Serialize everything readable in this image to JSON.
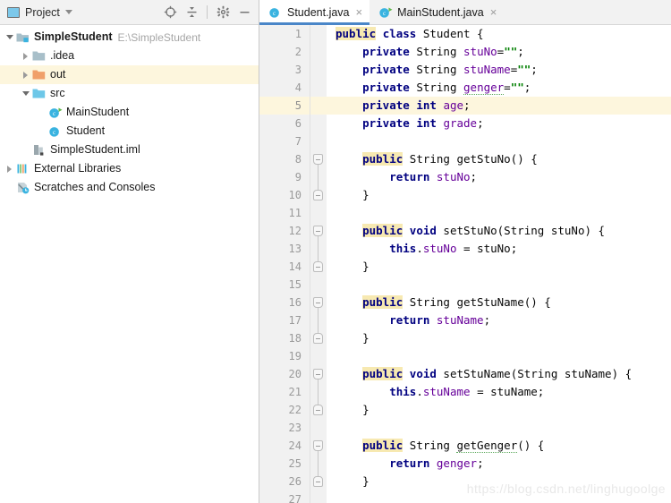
{
  "project_panel": {
    "header": {
      "icon": "project-window-icon",
      "title": "Project",
      "dropdown_icon": "chevron-down-icon",
      "actions": [
        {
          "name": "locate-in-tree-icon",
          "glyph": "target"
        },
        {
          "name": "collapse-all-icon",
          "glyph": "collapse"
        },
        {
          "name": "settings-gear-icon",
          "glyph": "gear"
        },
        {
          "name": "hide-panel-icon",
          "glyph": "minus"
        }
      ]
    },
    "tree": [
      {
        "label": "SimpleStudent",
        "path": "E:\\SimpleStudent",
        "icon": "module-icon",
        "twisty": "down",
        "indent": 0,
        "bold": true,
        "highlight": false
      },
      {
        "label": ".idea",
        "path": "",
        "icon": "folder-grey-icon",
        "twisty": "right",
        "indent": 1,
        "bold": false,
        "highlight": false
      },
      {
        "label": "out",
        "path": "",
        "icon": "folder-orange-icon",
        "twisty": "right",
        "indent": 1,
        "bold": false,
        "highlight": true
      },
      {
        "label": "src",
        "path": "",
        "icon": "folder-source-icon",
        "twisty": "down",
        "indent": 1,
        "bold": false,
        "highlight": false
      },
      {
        "label": "MainStudent",
        "path": "",
        "icon": "java-runnable-class-icon",
        "twisty": "none",
        "indent": 2,
        "bold": false,
        "highlight": false
      },
      {
        "label": "Student",
        "path": "",
        "icon": "java-class-icon",
        "twisty": "none",
        "indent": 2,
        "bold": false,
        "highlight": false
      },
      {
        "label": "SimpleStudent.iml",
        "path": "",
        "icon": "iml-file-icon",
        "twisty": "none",
        "indent": 1,
        "bold": false,
        "highlight": false
      },
      {
        "label": "External Libraries",
        "path": "",
        "icon": "libraries-icon",
        "twisty": "right",
        "indent": 0,
        "bold": false,
        "highlight": false
      },
      {
        "label": "Scratches and Consoles",
        "path": "",
        "icon": "scratches-icon",
        "twisty": "none",
        "indent": 0,
        "bold": false,
        "highlight": false
      }
    ]
  },
  "editor": {
    "tabs": [
      {
        "label": "Student.java",
        "icon": "java-class-icon",
        "active": true,
        "close_glyph": "×"
      },
      {
        "label": "MainStudent.java",
        "icon": "java-runnable-class-icon",
        "active": false,
        "close_glyph": "×"
      }
    ],
    "current_line": 5,
    "lines": [
      {
        "n": 1,
        "indent": 0,
        "tokens": [
          {
            "t": "public",
            "c": "kw-hl"
          },
          {
            "t": " ",
            "c": "plain"
          },
          {
            "t": "class",
            "c": "kw"
          },
          {
            "t": " Student {",
            "c": "plain"
          }
        ]
      },
      {
        "n": 2,
        "indent": 1,
        "tokens": [
          {
            "t": "private",
            "c": "kw"
          },
          {
            "t": " String ",
            "c": "plain"
          },
          {
            "t": "stuNo",
            "c": "fld"
          },
          {
            "t": "=",
            "c": "plain"
          },
          {
            "t": "\"\"",
            "c": "str"
          },
          {
            "t": ";",
            "c": "plain"
          }
        ]
      },
      {
        "n": 3,
        "indent": 1,
        "tokens": [
          {
            "t": "private",
            "c": "kw"
          },
          {
            "t": " String ",
            "c": "plain"
          },
          {
            "t": "stuName",
            "c": "fld"
          },
          {
            "t": "=",
            "c": "plain"
          },
          {
            "t": "\"\"",
            "c": "str"
          },
          {
            "t": ";",
            "c": "plain"
          }
        ]
      },
      {
        "n": 4,
        "indent": 1,
        "tokens": [
          {
            "t": "private",
            "c": "kw"
          },
          {
            "t": " String ",
            "c": "plain"
          },
          {
            "t": "genger",
            "c": "fld typo"
          },
          {
            "t": "=",
            "c": "plain"
          },
          {
            "t": "\"\"",
            "c": "str"
          },
          {
            "t": ";",
            "c": "plain"
          }
        ]
      },
      {
        "n": 5,
        "indent": 1,
        "tokens": [
          {
            "t": "private",
            "c": "kw"
          },
          {
            "t": " ",
            "c": "plain"
          },
          {
            "t": "int",
            "c": "kw"
          },
          {
            "t": " ",
            "c": "plain"
          },
          {
            "t": "age",
            "c": "fld"
          },
          {
            "t": ";",
            "c": "plain"
          }
        ]
      },
      {
        "n": 6,
        "indent": 1,
        "tokens": [
          {
            "t": "private",
            "c": "kw"
          },
          {
            "t": " ",
            "c": "plain"
          },
          {
            "t": "int",
            "c": "kw"
          },
          {
            "t": " ",
            "c": "plain"
          },
          {
            "t": "grade",
            "c": "fld"
          },
          {
            "t": ";",
            "c": "plain"
          }
        ]
      },
      {
        "n": 7,
        "indent": 0,
        "tokens": []
      },
      {
        "n": 8,
        "indent": 1,
        "tokens": [
          {
            "t": "public",
            "c": "kw-hl"
          },
          {
            "t": " String getStuNo() {",
            "c": "plain"
          }
        ]
      },
      {
        "n": 9,
        "indent": 2,
        "tokens": [
          {
            "t": "return",
            "c": "kw"
          },
          {
            "t": " ",
            "c": "plain"
          },
          {
            "t": "stuNo",
            "c": "fld"
          },
          {
            "t": ";",
            "c": "plain"
          }
        ]
      },
      {
        "n": 10,
        "indent": 1,
        "tokens": [
          {
            "t": "}",
            "c": "plain"
          }
        ]
      },
      {
        "n": 11,
        "indent": 0,
        "tokens": []
      },
      {
        "n": 12,
        "indent": 1,
        "tokens": [
          {
            "t": "public",
            "c": "kw-hl"
          },
          {
            "t": " ",
            "c": "plain"
          },
          {
            "t": "void",
            "c": "kw"
          },
          {
            "t": " setStuNo(String stuNo) {",
            "c": "plain"
          }
        ]
      },
      {
        "n": 13,
        "indent": 2,
        "tokens": [
          {
            "t": "this",
            "c": "kw"
          },
          {
            "t": ".",
            "c": "plain"
          },
          {
            "t": "stuNo",
            "c": "fld"
          },
          {
            "t": " = stuNo;",
            "c": "plain"
          }
        ]
      },
      {
        "n": 14,
        "indent": 1,
        "tokens": [
          {
            "t": "}",
            "c": "plain"
          }
        ]
      },
      {
        "n": 15,
        "indent": 0,
        "tokens": []
      },
      {
        "n": 16,
        "indent": 1,
        "tokens": [
          {
            "t": "public",
            "c": "kw-hl"
          },
          {
            "t": " String getStuName() {",
            "c": "plain"
          }
        ]
      },
      {
        "n": 17,
        "indent": 2,
        "tokens": [
          {
            "t": "return",
            "c": "kw"
          },
          {
            "t": " ",
            "c": "plain"
          },
          {
            "t": "stuName",
            "c": "fld"
          },
          {
            "t": ";",
            "c": "plain"
          }
        ]
      },
      {
        "n": 18,
        "indent": 1,
        "tokens": [
          {
            "t": "}",
            "c": "plain"
          }
        ]
      },
      {
        "n": 19,
        "indent": 0,
        "tokens": []
      },
      {
        "n": 20,
        "indent": 1,
        "tokens": [
          {
            "t": "public",
            "c": "kw-hl"
          },
          {
            "t": " ",
            "c": "plain"
          },
          {
            "t": "void",
            "c": "kw"
          },
          {
            "t": " setStuName(String stuName) {",
            "c": "plain"
          }
        ]
      },
      {
        "n": 21,
        "indent": 2,
        "tokens": [
          {
            "t": "this",
            "c": "kw"
          },
          {
            "t": ".",
            "c": "plain"
          },
          {
            "t": "stuName",
            "c": "fld"
          },
          {
            "t": " = stuName;",
            "c": "plain"
          }
        ]
      },
      {
        "n": 22,
        "indent": 1,
        "tokens": [
          {
            "t": "}",
            "c": "plain"
          }
        ]
      },
      {
        "n": 23,
        "indent": 0,
        "tokens": []
      },
      {
        "n": 24,
        "indent": 1,
        "tokens": [
          {
            "t": "public",
            "c": "kw-hl"
          },
          {
            "t": " String ",
            "c": "plain"
          },
          {
            "t": "getGenger",
            "c": "plain typo"
          },
          {
            "t": "() {",
            "c": "plain"
          }
        ]
      },
      {
        "n": 25,
        "indent": 2,
        "tokens": [
          {
            "t": "return",
            "c": "kw"
          },
          {
            "t": " ",
            "c": "plain"
          },
          {
            "t": "genger",
            "c": "fld"
          },
          {
            "t": ";",
            "c": "plain"
          }
        ]
      },
      {
        "n": 26,
        "indent": 1,
        "tokens": [
          {
            "t": "}",
            "c": "plain"
          }
        ]
      },
      {
        "n": 27,
        "indent": 0,
        "tokens": []
      }
    ],
    "folds": [
      {
        "start": 8,
        "end": 10
      },
      {
        "start": 12,
        "end": 14
      },
      {
        "start": 16,
        "end": 18
      },
      {
        "start": 20,
        "end": 22
      },
      {
        "start": 24,
        "end": 26
      }
    ]
  },
  "watermark": "https://blog.csdn.net/linghugoolge",
  "colors": {
    "accent_tab_underline": "#4a86c8",
    "current_line": "#fdf6dd",
    "keyword": "#000080",
    "field": "#660099",
    "string": "#008000",
    "class_icon": "#39b3e0",
    "folder_orange": "#f0a06a",
    "folder_blue": "#6dc7e8",
    "gutter": "#f1f1f1"
  }
}
